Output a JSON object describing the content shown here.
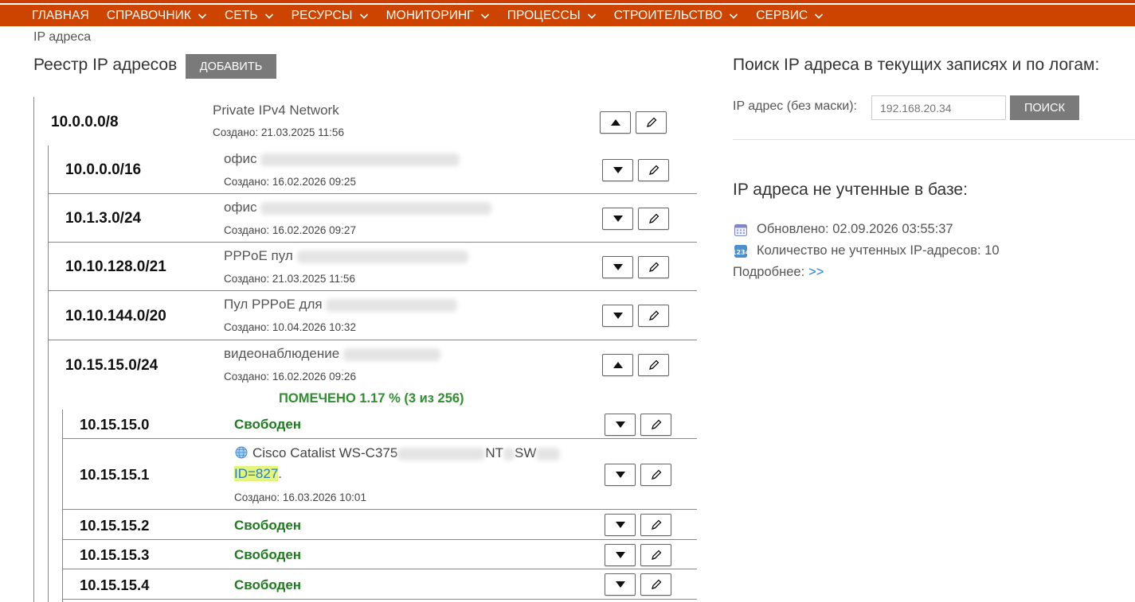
{
  "nav": {
    "items": [
      {
        "label": "ГЛАВНАЯ",
        "dropdown": false
      },
      {
        "label": "СПРАВОЧНИК",
        "dropdown": true
      },
      {
        "label": "СЕТЬ",
        "dropdown": true
      },
      {
        "label": "РЕСУРСЫ",
        "dropdown": true
      },
      {
        "label": "МОНИТОРИНГ",
        "dropdown": true
      },
      {
        "label": "ПРОЦЕССЫ",
        "dropdown": true
      },
      {
        "label": "СТРОИТЕЛЬСТВО",
        "dropdown": true
      },
      {
        "label": "СЕРВИС",
        "dropdown": true
      }
    ]
  },
  "breadcrumb": "IP адреса",
  "registry": {
    "title": "Реестр IP адресов",
    "add_label": "ДОБАВИТЬ",
    "root": {
      "network": "10.0.0.0/8",
      "desc": "Private IPv4 Network",
      "created": "Создано: 21.03.2025 11:56",
      "state": "expanded"
    },
    "subnets": [
      {
        "network": "10.0.0.0/16",
        "desc": "офис",
        "created": "Создано: 16.02.2026 09:25",
        "state": "collapsed"
      },
      {
        "network": "10.1.3.0/24",
        "desc": "офис",
        "created": "Создано: 16.02.2026 09:27",
        "state": "collapsed"
      },
      {
        "network": "10.10.128.0/21",
        "desc": "PPPoE пул",
        "created": "Создано: 21.03.2025 11:56",
        "state": "collapsed"
      },
      {
        "network": "10.10.144.0/20",
        "desc": "Пул PPPoE для",
        "created": "Создано: 10.04.2026 10:32",
        "state": "collapsed"
      },
      {
        "network": "10.15.15.0/24",
        "desc": "видеонаблюдение",
        "created": "Создано: 16.02.2026 09:26",
        "state": "expanded"
      }
    ],
    "marked": "ПОМЕЧЕНО 1.17 % (3 из 256)",
    "hosts": [
      {
        "ip": "10.15.15.0",
        "status": "Свободен"
      },
      {
        "ip": "10.15.15.1",
        "device": "Cisco Catalist WS-C375",
        "device_tail": "NT",
        "device_tail2": "SW",
        "id_link": "ID=827",
        "id_suffix": ".",
        "created": "Создано: 16.03.2026 10:01"
      },
      {
        "ip": "10.15.15.2",
        "status": "Свободен"
      },
      {
        "ip": "10.15.15.3",
        "status": "Свободен"
      },
      {
        "ip": "10.15.15.4",
        "status": "Свободен"
      }
    ]
  },
  "search": {
    "title": "Поиск IP адреса в текущих записях и по логам:",
    "label": "IP адрес (без маски):",
    "placeholder": "192.168.20.34",
    "button_label": "ПОИСК"
  },
  "unaccounted": {
    "title": "IP адреса не учтенные в базе:",
    "updated": "Обновлено: 02.09.2026 03:55:37",
    "count": "Количество не учтенных IP-адресов: 10",
    "more_label": "Подробнее:",
    "more_link": ">>"
  },
  "colors": {
    "nav_bg": "#cc4400",
    "free_green": "#1f7a1f",
    "link_blue": "#2a7cc7",
    "highlight": "#e3f57a"
  }
}
